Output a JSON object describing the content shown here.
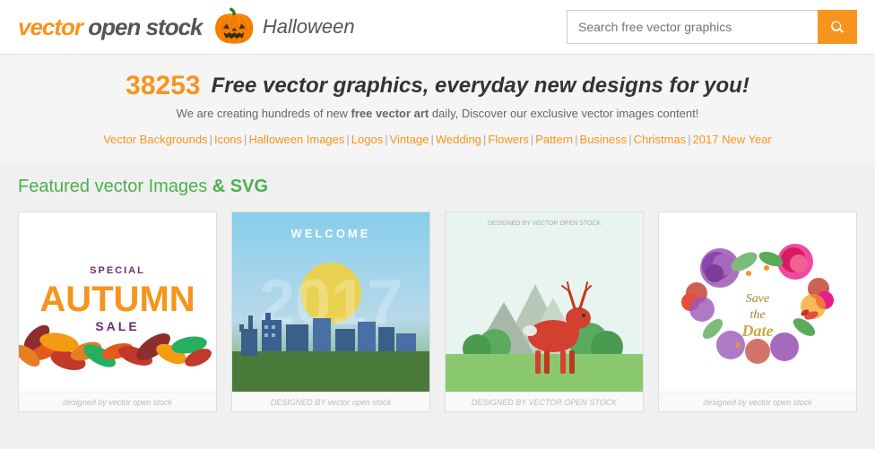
{
  "header": {
    "logo_vector": "vector",
    "logo_open_stock": " open stock",
    "halloween_label": "Halloween",
    "search_placeholder": "Search free vector graphics"
  },
  "banner": {
    "count": "38253",
    "tagline": "Free vector graphics, everyday new designs for you!",
    "subtitle_prefix": "We are creating hundreds of new ",
    "subtitle_bold": "free vector art",
    "subtitle_suffix": " daily, Discover our exclusive vector images content!"
  },
  "nav": {
    "links": [
      "Vector Backgrounds",
      "Icons",
      "Halloween Images",
      "Logos",
      "Vintage",
      "Wedding",
      "Flowers",
      "Pattern",
      "Business",
      "Christmas",
      "2017 New Year"
    ]
  },
  "featured": {
    "title_normal": "Featured vector Images",
    "title_bold": " & SVG"
  },
  "cards": [
    {
      "id": "card1",
      "label": "Special Autumn Sale",
      "footer": "designed by vector open stock"
    },
    {
      "id": "card2",
      "label": "Welcome 2017",
      "footer": "DESIGNED BY vector open stock"
    },
    {
      "id": "card3",
      "label": "Deer Design",
      "footer": "DESIGNED BY VECTOR OPEN STOCK"
    },
    {
      "id": "card4",
      "label": "Save the Date",
      "footer": "designed by vector open stock"
    }
  ]
}
